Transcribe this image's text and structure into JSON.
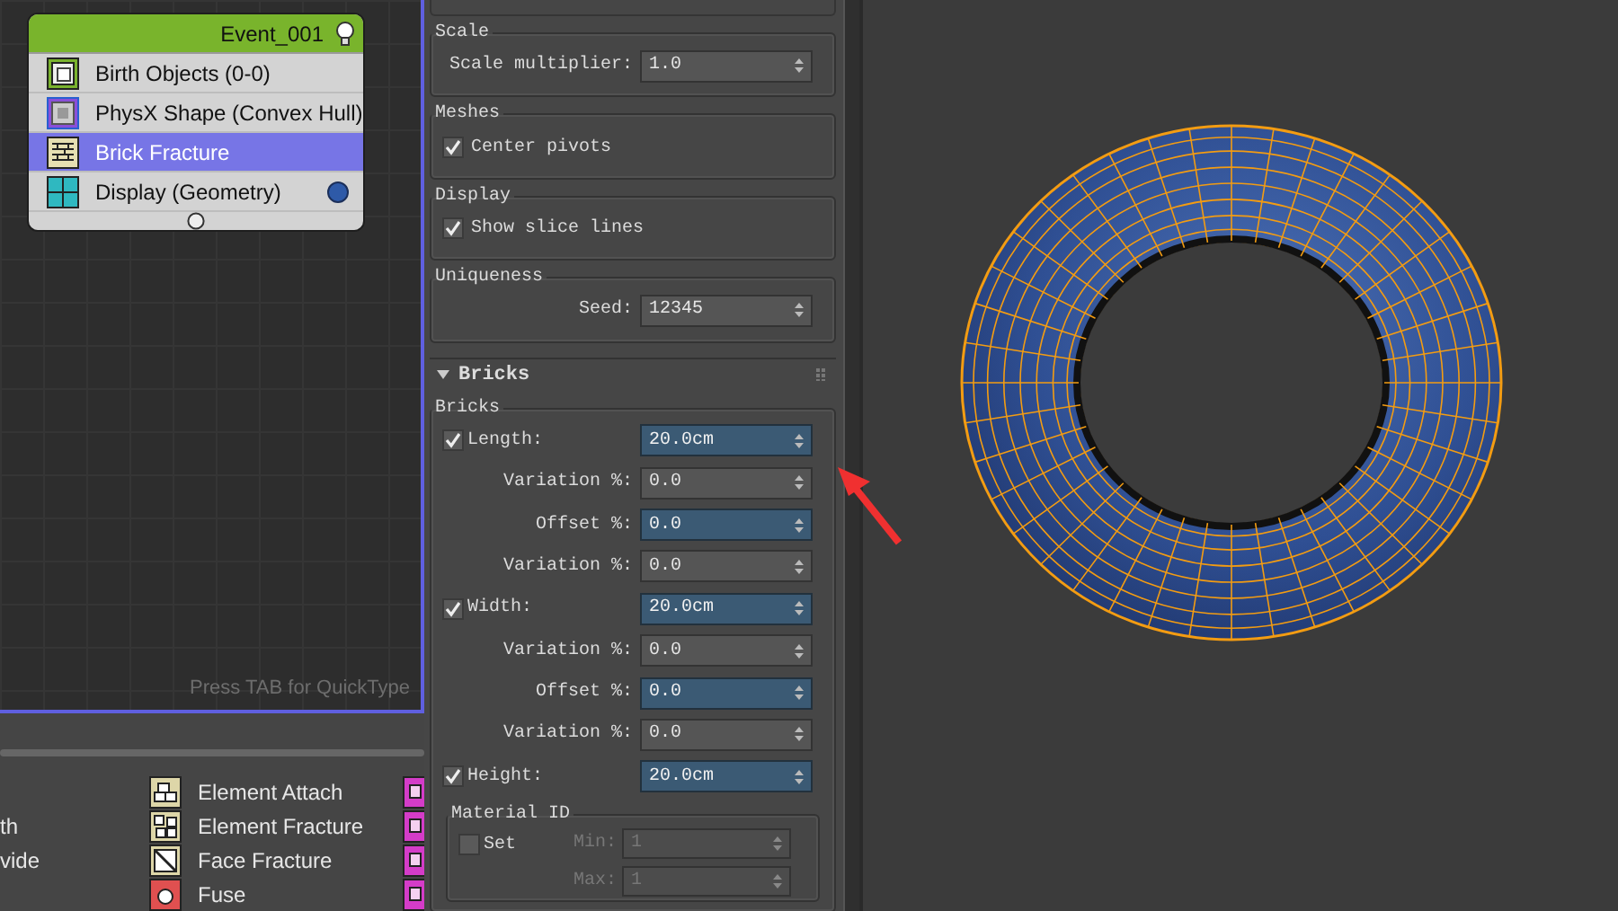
{
  "node_editor": {
    "event": {
      "title": "Event_001",
      "operators": [
        {
          "kind": "birth",
          "label": "Birth Objects (0-0)",
          "selected": false
        },
        {
          "kind": "shape",
          "label": "PhysX Shape (Convex Hull)",
          "selected": false
        },
        {
          "kind": "fracture",
          "label": "Brick Fracture",
          "selected": true
        },
        {
          "kind": "display",
          "label": "Display (Geometry)",
          "selected": false
        }
      ]
    },
    "hint": "Press TAB for QuickType"
  },
  "depot": {
    "rows": [
      {
        "kind": "attach",
        "label": "Element Attach"
      },
      {
        "kind": "fracture",
        "left_text": "th",
        "label": "Element Fracture"
      },
      {
        "kind": "face",
        "left_text": "vide",
        "label": "Face Fracture"
      },
      {
        "kind": "fuse",
        "label": "Fuse"
      }
    ]
  },
  "parameters": {
    "groups": [
      {
        "title": "Scale",
        "rows": [
          {
            "kind": "field",
            "label": "Scale multiplier:",
            "field": {
              "value": "1.0",
              "highlighted": false
            }
          }
        ]
      },
      {
        "title": "Meshes",
        "rows": [
          {
            "kind": "check",
            "label": "Center pivots",
            "checked": true
          }
        ]
      },
      {
        "title": "Display",
        "rows": [
          {
            "kind": "check",
            "label": "Show slice lines",
            "checked": true
          }
        ]
      },
      {
        "title": "Uniqueness",
        "rows": [
          {
            "kind": "field",
            "label": "Seed:",
            "field": {
              "value": "12345",
              "highlighted": false
            }
          }
        ]
      }
    ],
    "rollout": {
      "title": "Bricks",
      "expanded": true,
      "group": {
        "title": "Bricks",
        "rows": [
          {
            "kind": "check-field",
            "label": "Length:",
            "checked": true,
            "field": {
              "value": "20.0cm",
              "highlighted": true
            }
          },
          {
            "kind": "field",
            "label": "Variation %:",
            "field": {
              "value": "0.0",
              "highlighted": false
            }
          },
          {
            "kind": "field",
            "label": "Offset %:",
            "field": {
              "value": "0.0",
              "highlighted": true
            }
          },
          {
            "kind": "field",
            "label": "Variation %:",
            "field": {
              "value": "0.0",
              "highlighted": false
            }
          },
          {
            "kind": "check-field",
            "label": "Width:",
            "checked": true,
            "field": {
              "value": "20.0cm",
              "highlighted": true
            }
          },
          {
            "kind": "field",
            "label": "Variation %:",
            "field": {
              "value": "0.0",
              "highlighted": false
            }
          },
          {
            "kind": "field",
            "label": "Offset %:",
            "field": {
              "value": "0.0",
              "highlighted": true
            }
          },
          {
            "kind": "field",
            "label": "Variation %:",
            "field": {
              "value": "0.0",
              "highlighted": false
            }
          },
          {
            "kind": "check-field",
            "label": "Height:",
            "checked": true,
            "field": {
              "value": "20.0cm",
              "highlighted": true
            }
          }
        ],
        "subgroup": {
          "title": "Material ID",
          "rows": [
            {
              "kind": "range",
              "label": "Set",
              "checked": false,
              "fields": [
                {
                  "label": "Min:",
                  "value": "1",
                  "disabled": true
                },
                {
                  "label": "Max:",
                  "value": "1",
                  "disabled": true
                }
              ]
            }
          ]
        }
      }
    }
  }
}
